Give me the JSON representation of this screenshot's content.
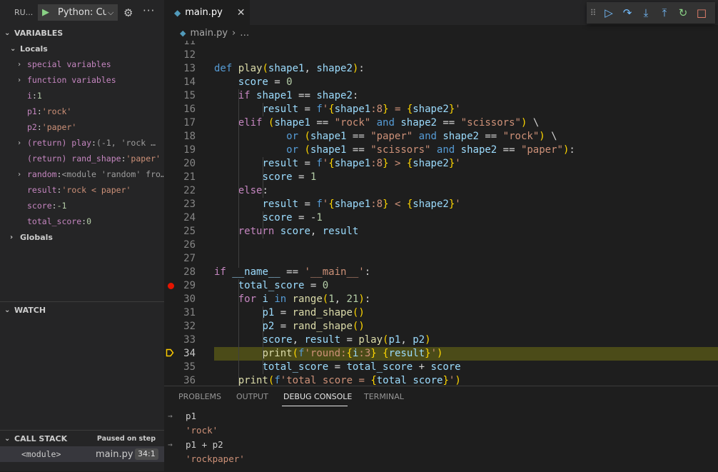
{
  "sidebar": {
    "title": "RU...",
    "run_config": "Python: Cu",
    "variables_header": "VARIABLES",
    "locals_label": "Locals",
    "variables": [
      {
        "name": "special variables",
        "sep": "",
        "value": "",
        "kind": "",
        "expandable": true,
        "indent": 1
      },
      {
        "name": "function variables",
        "sep": "",
        "value": "",
        "kind": "",
        "expandable": true,
        "indent": 1
      },
      {
        "name": "i",
        "sep": ": ",
        "value": "1",
        "kind": "n",
        "expandable": false,
        "indent": 1
      },
      {
        "name": "p1",
        "sep": ": ",
        "value": "'rock'",
        "kind": "s",
        "expandable": false,
        "indent": 1
      },
      {
        "name": "p2",
        "sep": ": ",
        "value": "'paper'",
        "kind": "s",
        "expandable": false,
        "indent": 1
      },
      {
        "name": "(return) play",
        "sep": ": ",
        "value": "(-1, 'rock    …",
        "kind": "g",
        "expandable": true,
        "indent": 1
      },
      {
        "name": "(return) rand_shape",
        "sep": ": ",
        "value": "'paper'",
        "kind": "s",
        "expandable": false,
        "indent": 1
      },
      {
        "name": "random",
        "sep": ": ",
        "value": "<module 'random' fro…",
        "kind": "g",
        "expandable": true,
        "indent": 1
      },
      {
        "name": "result",
        "sep": ": ",
        "value": "'rock     < paper'",
        "kind": "s",
        "expandable": false,
        "indent": 1
      },
      {
        "name": "score",
        "sep": ": ",
        "value": "-1",
        "kind": "n",
        "expandable": false,
        "indent": 1
      },
      {
        "name": "total_score",
        "sep": ": ",
        "value": "0",
        "kind": "n",
        "expandable": false,
        "indent": 1
      }
    ],
    "globals_label": "Globals",
    "watch_header": "WATCH",
    "callstack_header": "CALL STACK",
    "callstack_status": "Paused on step",
    "callstack_frame": {
      "name": "<module>",
      "file": "main.py",
      "position": "34:1"
    }
  },
  "editor": {
    "tab_label": "main.py",
    "breadcrumb_file": "main.py",
    "breadcrumb_more": "…",
    "current_line": 34,
    "breakpoint_line": 29,
    "lines": [
      {
        "n": "11",
        "t": ""
      },
      {
        "n": "12",
        "t": ""
      },
      {
        "n": "13",
        "t": "def play(shape1, shape2):"
      },
      {
        "n": "14",
        "t": "    score = 0"
      },
      {
        "n": "15",
        "t": "    if shape1 == shape2:"
      },
      {
        "n": "16",
        "t": "        result = f'{shape1:8} = {shape2}'"
      },
      {
        "n": "17",
        "t": "    elif (shape1 == \"rock\" and shape2 == \"scissors\") \\"
      },
      {
        "n": "18",
        "t": "            or (shape1 == \"paper\" and shape2 == \"rock\") \\"
      },
      {
        "n": "19",
        "t": "            or (shape1 == \"scissors\" and shape2 == \"paper\"):"
      },
      {
        "n": "20",
        "t": "        result = f'{shape1:8} > {shape2}'"
      },
      {
        "n": "21",
        "t": "        score = 1"
      },
      {
        "n": "22",
        "t": "    else:"
      },
      {
        "n": "23",
        "t": "        result = f'{shape1:8} < {shape2}'"
      },
      {
        "n": "24",
        "t": "        score = -1"
      },
      {
        "n": "25",
        "t": "    return score, result"
      },
      {
        "n": "26",
        "t": ""
      },
      {
        "n": "27",
        "t": ""
      },
      {
        "n": "28",
        "t": "if __name__ == '__main__':"
      },
      {
        "n": "29",
        "t": "    total_score = 0"
      },
      {
        "n": "30",
        "t": "    for i in range(1, 21):"
      },
      {
        "n": "31",
        "t": "        p1 = rand_shape()"
      },
      {
        "n": "32",
        "t": "        p2 = rand_shape()"
      },
      {
        "n": "33",
        "t": "        score, result = play(p1, p2)"
      },
      {
        "n": "34",
        "t": "        print(f'round:{i:3} {result}')"
      },
      {
        "n": "35",
        "t": "        total_score = total_score + score"
      },
      {
        "n": "36",
        "t": "    print(f'total score = {total_score}')"
      }
    ]
  },
  "debug_toolbar": {
    "icons": [
      "drag-handle-icon",
      "continue-icon",
      "step-over-icon",
      "step-into-icon",
      "step-out-icon",
      "restart-icon",
      "stop-icon"
    ]
  },
  "panel": {
    "tabs": [
      "PROBLEMS",
      "OUTPUT",
      "DEBUG CONSOLE",
      "TERMINAL"
    ],
    "active_tab": "DEBUG CONSOLE",
    "console": [
      {
        "type": "input",
        "text": "p1"
      },
      {
        "type": "output",
        "text": "'rock'"
      },
      {
        "type": "input",
        "text": "p1 + p2"
      },
      {
        "type": "output",
        "text": "'rockpaper'"
      }
    ]
  },
  "colors": {
    "current_line_highlight": "#4b4b18",
    "breakpoint": "#e51400",
    "pointer": "#ffcc00",
    "accent": "#007acc"
  }
}
